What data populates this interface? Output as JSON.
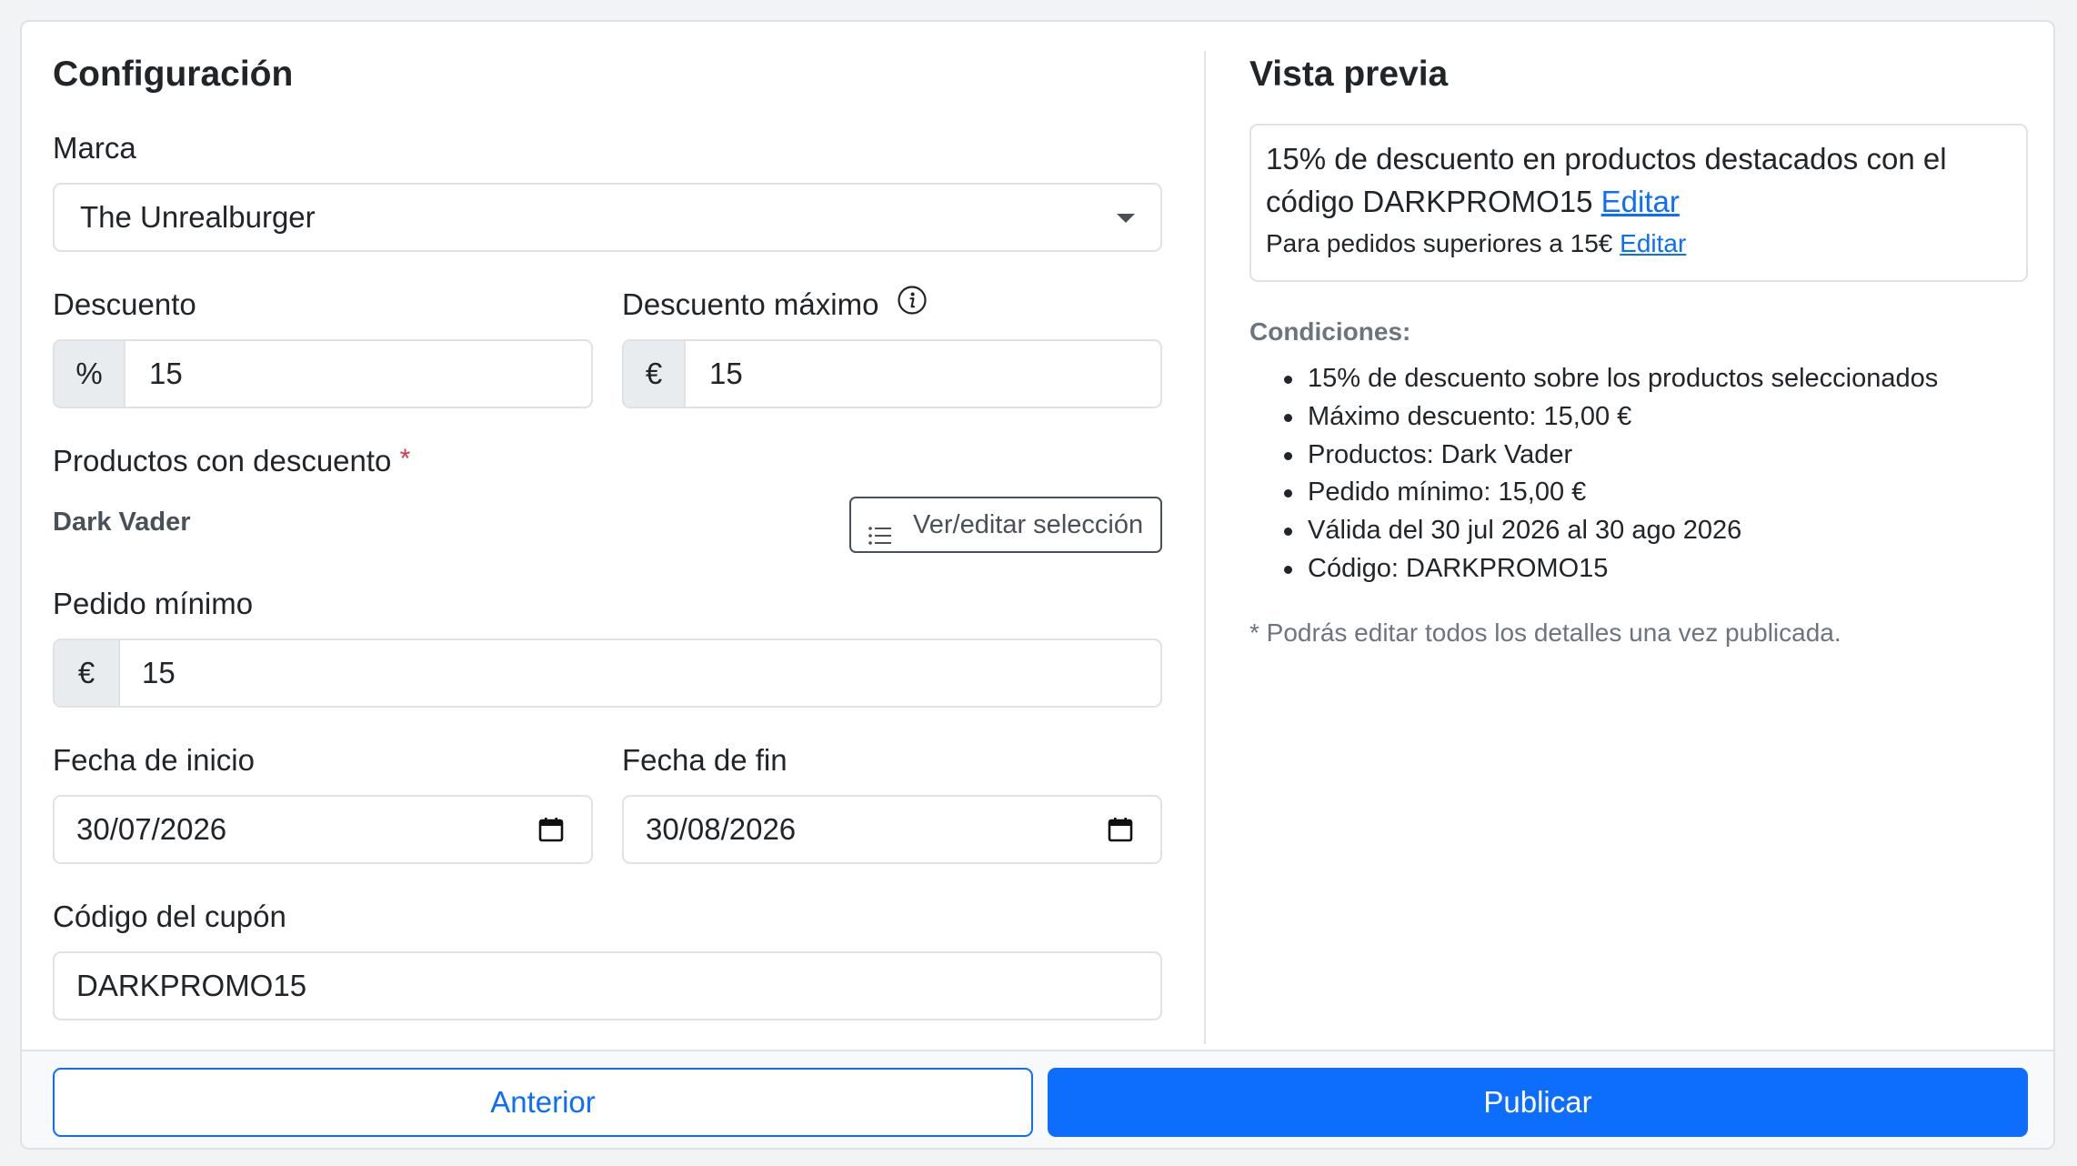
{
  "config": {
    "title": "Configuración",
    "brand": {
      "label": "Marca",
      "value": "The Unrealburger"
    },
    "discount": {
      "label": "Descuento",
      "addon": "%",
      "value": "15"
    },
    "max_discount": {
      "label": "Descuento máximo",
      "addon": "€",
      "value": "15",
      "info_icon": "info-circle-icon"
    },
    "products": {
      "label": "Productos con descuento",
      "required_mark": "*",
      "selected": "Dark Vader",
      "button_label": "Ver/editar selección",
      "button_icon": "list-icon"
    },
    "min_order": {
      "label": "Pedido mínimo",
      "addon": "€",
      "value": "15"
    },
    "start_date": {
      "label": "Fecha de inicio",
      "value": "30/07/2026",
      "icon": "calendar-icon"
    },
    "end_date": {
      "label": "Fecha de fin",
      "value": "30/08/2026",
      "icon": "calendar-icon"
    },
    "coupon": {
      "label": "Código del cupón",
      "value": "DARKPROMO15"
    }
  },
  "preview": {
    "title": "Vista previa",
    "line1": "15% de descuento en productos destacados con el",
    "line2": "código DARKPROMO15",
    "line3": "Para pedidos superiores a 15€",
    "edit_link": "Editar",
    "conditions_title": "Condiciones:",
    "conditions": [
      "15% de descuento sobre los productos seleccionados",
      "Máximo descuento: 15,00 €",
      "Productos: Dark Vader",
      "Pedido mínimo: 15,00 €",
      "Válida del 30 jul 2026 al 30 ago 2026",
      "Código: DARKPROMO15"
    ],
    "note": "* Podrás editar todos los detalles una vez publicada."
  },
  "footer": {
    "back_label": "Anterior",
    "publish_label": "Publicar"
  },
  "colors": {
    "primary": "#0d6efd",
    "required": "#dc3545",
    "muted": "#6c757d",
    "border": "#dee2e6"
  }
}
